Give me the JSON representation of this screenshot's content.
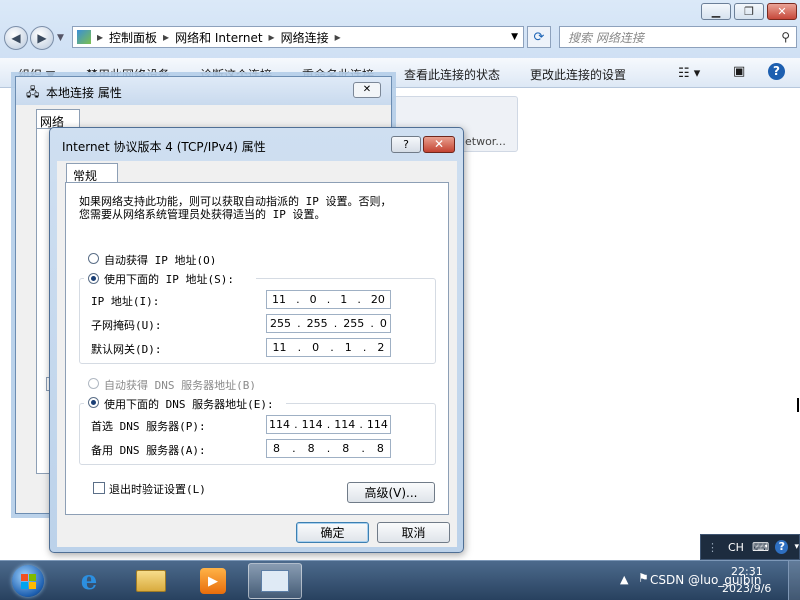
{
  "explorer": {
    "breadcrumb": [
      "控制面板",
      "网络和 Internet",
      "网络连接"
    ],
    "search_placeholder": "搜索 网络连接",
    "toolbar": [
      "组织 ▼",
      "禁用此网络设备",
      "诊断这个连接",
      "重命名此连接",
      "查看此连接的状态",
      "更改此连接的设置"
    ],
    "adapter_card_text": "etwor..."
  },
  "bg_dialog": {
    "title": "本地连接 属性",
    "tab": "网络"
  },
  "dialog": {
    "title": "Internet 协议版本 4 (TCP/IPv4) 属性",
    "help": "?",
    "close": "✕",
    "tab": "常规",
    "intro": "如果网络支持此功能，则可以获取自动指派的 IP 设置。否则，您需要从网络系统管理员处获得适当的 IP 设置。",
    "auto_ip": "自动获得 IP 地址(O)",
    "manual_ip": "使用下面的 IP 地址(S):",
    "ip_label": "IP 地址(I):",
    "ip": [
      "11",
      "0",
      "1",
      "20"
    ],
    "mask_label": "子网掩码(U):",
    "mask": [
      "255",
      "255",
      "255",
      "0"
    ],
    "gw_label": "默认网关(D):",
    "gw": [
      "11",
      "0",
      "1",
      "2"
    ],
    "auto_dns": "自动获得 DNS 服务器地址(B)",
    "manual_dns": "使用下面的 DNS 服务器地址(E):",
    "dns1_label": "首选 DNS 服务器(P):",
    "dns1": [
      "114",
      "114",
      "114",
      "114"
    ],
    "dns2_label": "备用 DNS 服务器(A):",
    "dns2": [
      "8",
      "8",
      "8",
      "8"
    ],
    "validate": "退出时验证设置(L)",
    "advanced": "高级(V)...",
    "ok": "确定",
    "cancel": "取消"
  },
  "taskbar": {
    "lang": "CH",
    "time": "22:31",
    "date": "2023/9/6",
    "watermark": "CSDN @luo_guibin"
  }
}
